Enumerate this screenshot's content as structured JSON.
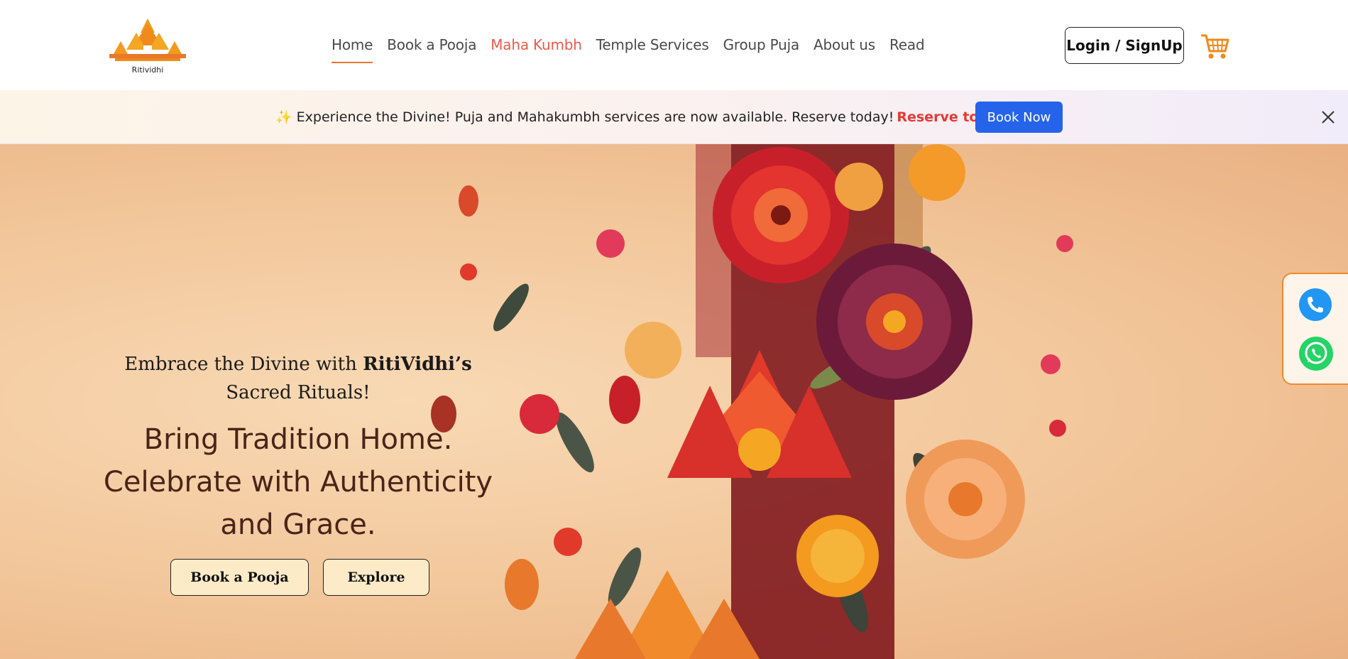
{
  "header": {
    "logo_text": "Ritividhi",
    "nav": [
      {
        "label": "Home",
        "active": true
      },
      {
        "label": "Book a Pooja"
      },
      {
        "label": "Maha Kumbh",
        "highlight": true
      },
      {
        "label": "Temple Services"
      },
      {
        "label": "Group Puja"
      },
      {
        "label": "About us"
      },
      {
        "label": "Read"
      }
    ],
    "login_label": "Login / SignUp",
    "cart_icon": "cart-icon"
  },
  "announcement": {
    "sparkle": "✨",
    "text": "Experience the Divine! Puja and Mahakumbh services are now available. Reserve today!",
    "highlight": "Reserve today!",
    "button_label": "Book Now",
    "close_icon": "close-icon"
  },
  "hero": {
    "subtitle_prefix": "Embrace the Divine with ",
    "subtitle_brand": "RitiVidhi’s",
    "subtitle_suffix": " Sacred Rituals!",
    "title": "Bring Tradition Home. Celebrate with Authenticity and Grace.",
    "primary_button": "Book a Pooja",
    "secondary_button": "Explore"
  },
  "floating_contact": {
    "phone_icon": "phone-icon",
    "whatsapp_icon": "whatsapp-icon"
  },
  "colors": {
    "accent_orange": "#e8782b",
    "highlight_red": "#ec5a4b",
    "reserve_red": "#e53935",
    "book_now_blue": "#2563eb",
    "phone_blue": "#2196f3",
    "whatsapp_green": "#25d366"
  }
}
